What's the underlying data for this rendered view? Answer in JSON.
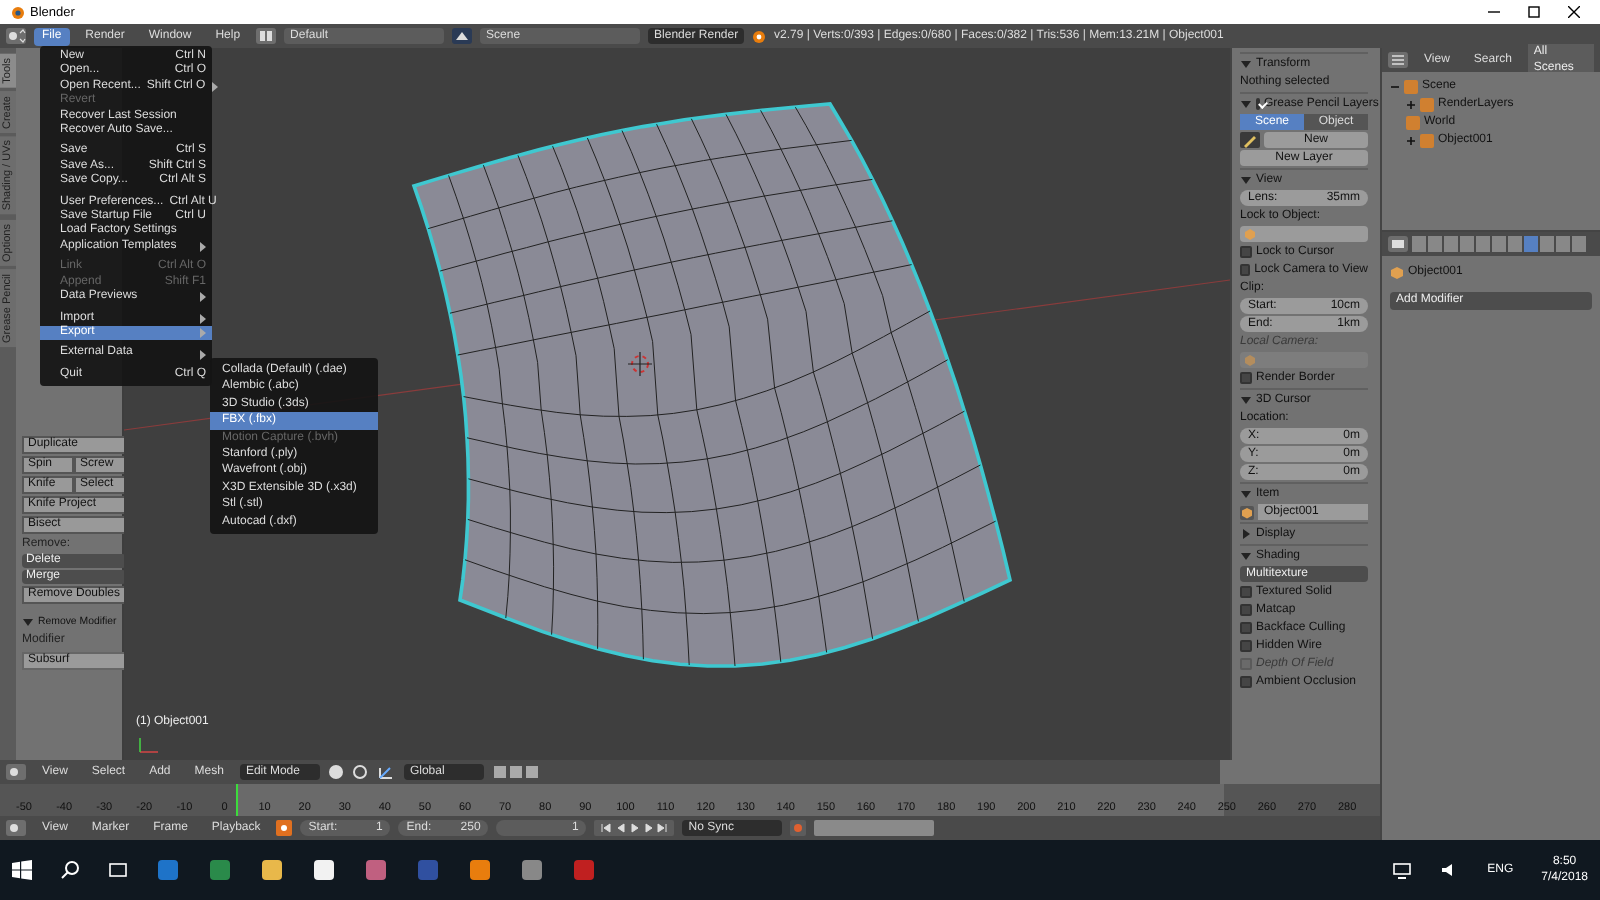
{
  "window": {
    "title": "Blender"
  },
  "info_header": {
    "menus": [
      {
        "label": "File",
        "selected": true
      },
      {
        "label": "Render",
        "selected": false
      },
      {
        "label": "Window",
        "selected": false
      },
      {
        "label": "Help",
        "selected": false
      }
    ],
    "layout": "Default",
    "scene": "Scene",
    "engine": "Blender Render",
    "stats": "v2.79 | Verts:0/393 | Edges:0/680 | Faces:0/382 | Tris:536 | Mem:13.21M | Object001"
  },
  "file_menu": {
    "items": [
      {
        "kind": "item",
        "label": "New",
        "shortcut": "Ctrl N",
        "disabled": false,
        "submenu": false,
        "selected": false
      },
      {
        "kind": "item",
        "label": "Open...",
        "shortcut": "Ctrl O",
        "disabled": false,
        "submenu": false,
        "selected": false
      },
      {
        "kind": "item",
        "label": "Open Recent...",
        "shortcut": "Shift Ctrl O",
        "disabled": false,
        "submenu": true,
        "selected": false
      },
      {
        "kind": "item",
        "label": "Revert",
        "disabled": true,
        "submenu": false,
        "selected": false
      },
      {
        "kind": "item",
        "label": "Recover Last Session",
        "disabled": false,
        "submenu": false,
        "selected": false
      },
      {
        "kind": "item",
        "label": "Recover Auto Save...",
        "disabled": false,
        "submenu": false,
        "selected": false
      },
      {
        "kind": "separator"
      },
      {
        "kind": "item",
        "label": "Save",
        "shortcut": "Ctrl S",
        "disabled": false,
        "submenu": false,
        "selected": false
      },
      {
        "kind": "item",
        "label": "Save As...",
        "shortcut": "Shift Ctrl S",
        "disabled": false,
        "submenu": false,
        "selected": false
      },
      {
        "kind": "item",
        "label": "Save Copy...",
        "shortcut": "Ctrl Alt S",
        "disabled": false,
        "submenu": false,
        "selected": false
      },
      {
        "kind": "separator"
      },
      {
        "kind": "item",
        "label": "User Preferences...",
        "shortcut": "Ctrl Alt U",
        "disabled": false,
        "submenu": false,
        "selected": false
      },
      {
        "kind": "item",
        "label": "Save Startup File",
        "shortcut": "Ctrl U",
        "disabled": false,
        "submenu": false,
        "selected": false
      },
      {
        "kind": "item",
        "label": "Load Factory Settings",
        "disabled": false,
        "submenu": false,
        "selected": false
      },
      {
        "kind": "item",
        "label": "Application Templates",
        "disabled": false,
        "submenu": true,
        "selected": false
      },
      {
        "kind": "separator"
      },
      {
        "kind": "item",
        "label": "Link",
        "shortcut": "Ctrl Alt O",
        "disabled": true,
        "submenu": false,
        "selected": false
      },
      {
        "kind": "item",
        "label": "Append",
        "shortcut": "Shift F1",
        "disabled": true,
        "submenu": false,
        "selected": false
      },
      {
        "kind": "item",
        "label": "Data Previews",
        "disabled": false,
        "submenu": true,
        "selected": false
      },
      {
        "kind": "separator"
      },
      {
        "kind": "item",
        "label": "Import",
        "disabled": false,
        "submenu": true,
        "selected": false
      },
      {
        "kind": "item",
        "label": "Export",
        "disabled": false,
        "submenu": true,
        "selected": true
      },
      {
        "kind": "separator"
      },
      {
        "kind": "item",
        "label": "External Data",
        "disabled": false,
        "submenu": true,
        "selected": false
      },
      {
        "kind": "separator"
      },
      {
        "kind": "item",
        "label": "Quit",
        "shortcut": "Ctrl Q",
        "disabled": false,
        "submenu": false,
        "selected": false
      }
    ]
  },
  "export_menu": {
    "items": [
      {
        "label": "Collada (Default) (.dae)",
        "disabled": false,
        "selected": false
      },
      {
        "label": "Alembic (.abc)",
        "disabled": false,
        "selected": false
      },
      {
        "label": "3D Studio (.3ds)",
        "disabled": false,
        "selected": false
      },
      {
        "label": "FBX (.fbx)",
        "disabled": false,
        "selected": true
      },
      {
        "label": "Motion Capture (.bvh)",
        "disabled": true,
        "selected": false
      },
      {
        "label": "Stanford (.ply)",
        "disabled": false,
        "selected": false
      },
      {
        "label": "Wavefront (.obj)",
        "disabled": false,
        "selected": false
      },
      {
        "label": "X3D Extensible 3D (.x3d)",
        "disabled": false,
        "selected": false
      },
      {
        "label": "Stl (.stl)",
        "disabled": false,
        "selected": false
      },
      {
        "label": "Autocad (.dxf)",
        "disabled": false,
        "selected": false
      }
    ]
  },
  "toolshelf": {
    "tabs": [
      {
        "label": "Tools",
        "selected": true
      },
      {
        "label": "Create",
        "selected": false
      },
      {
        "label": "Shading / UVs",
        "selected": false
      },
      {
        "label": "Options",
        "selected": false
      },
      {
        "label": "Grease Pencil",
        "selected": false
      }
    ],
    "rows": [
      {
        "kind": "buttons",
        "labels": [
          "Duplicate"
        ]
      },
      {
        "kind": "buttons",
        "labels": [
          "Spin",
          "Screw"
        ]
      },
      {
        "kind": "buttons",
        "labels": [
          "Knife",
          "Select"
        ]
      },
      {
        "kind": "buttons",
        "labels": [
          "Knife Project"
        ]
      },
      {
        "kind": "buttons",
        "labels": [
          "Bisect"
        ]
      },
      {
        "kind": "heading",
        "label": "Remove:"
      },
      {
        "kind": "dropdown",
        "label": "Delete"
      },
      {
        "kind": "dropdown",
        "label": "Merge"
      },
      {
        "kind": "buttons",
        "labels": [
          "Remove Doubles"
        ]
      }
    ],
    "operator": {
      "title": "Remove Modifier",
      "expanded": true,
      "field_label": "Modifier",
      "field_value": "Subsurf"
    }
  },
  "viewport": {
    "object_label": "(1) Object001"
  },
  "view3d_header": {
    "menus": [
      "View",
      "Select",
      "Add",
      "Mesh"
    ],
    "mode": "Edit Mode",
    "orientation": "Global"
  },
  "n_panel": {
    "rows": [
      {
        "kind": "panel",
        "label": "Transform",
        "expanded": true
      },
      {
        "kind": "text",
        "label": "Nothing selected"
      },
      {
        "kind": "panel_check",
        "label": "Grease Pencil Layers",
        "expanded": true,
        "checked": true
      },
      {
        "kind": "tabs",
        "items": [
          {
            "label": "Scene",
            "selected": true
          },
          {
            "label": "Object",
            "selected": false
          }
        ]
      },
      {
        "kind": "pencil_new",
        "label": "New"
      },
      {
        "kind": "button",
        "label": "New Layer"
      },
      {
        "kind": "panel",
        "label": "View",
        "expanded": true
      },
      {
        "kind": "number",
        "label": "Lens:",
        "value": "35mm"
      },
      {
        "kind": "label",
        "label": "Lock to Object:",
        "disabled": false
      },
      {
        "kind": "object_field",
        "disabled": false
      },
      {
        "kind": "check",
        "label": "Lock to Cursor",
        "checked": false,
        "disabled": false
      },
      {
        "kind": "check",
        "label": "Lock Camera to View",
        "checked": false,
        "disabled": false
      },
      {
        "kind": "label",
        "label": "Clip:",
        "disabled": false
      },
      {
        "kind": "number",
        "label": "Start:",
        "value": "10cm"
      },
      {
        "kind": "number",
        "label": "End:",
        "value": "1km"
      },
      {
        "kind": "label",
        "label": "Local Camera:",
        "disabled": true
      },
      {
        "kind": "object_field",
        "disabled": true
      },
      {
        "kind": "check",
        "label": "Render Border",
        "checked": false,
        "disabled": false
      },
      {
        "kind": "panel",
        "label": "3D Cursor",
        "expanded": true
      },
      {
        "kind": "label",
        "label": "Location:",
        "disabled": false
      },
      {
        "kind": "number",
        "label": "X:",
        "value": "0m"
      },
      {
        "kind": "number",
        "label": "Y:",
        "value": "0m"
      },
      {
        "kind": "number",
        "label": "Z:",
        "value": "0m"
      },
      {
        "kind": "panel",
        "label": "Item",
        "expanded": true
      },
      {
        "kind": "name_field",
        "value": "Object001"
      },
      {
        "kind": "panel",
        "label": "Display",
        "expanded": false
      },
      {
        "kind": "panel",
        "label": "Shading",
        "expanded": true
      },
      {
        "kind": "dropdown",
        "label": "Multitexture"
      },
      {
        "kind": "check",
        "label": "Textured Solid",
        "checked": false,
        "disabled": false
      },
      {
        "kind": "check",
        "label": "Matcap",
        "checked": false,
        "disabled": false
      },
      {
        "kind": "check",
        "label": "Backface Culling",
        "checked": false,
        "disabled": false
      },
      {
        "kind": "check",
        "label": "Hidden Wire",
        "checked": false,
        "disabled": false
      },
      {
        "kind": "check",
        "label": "Depth Of Field",
        "checked": false,
        "disabled": true
      },
      {
        "kind": "check",
        "label": "Ambient Occlusion",
        "checked": false,
        "disabled": false
      }
    ]
  },
  "outliner": {
    "menus": [
      "View",
      "Search"
    ],
    "filter": "All Scenes",
    "tree": [
      {
        "label": "Scene",
        "expanded": true,
        "children": [
          {
            "label": "RenderLayers",
            "expanded": false
          },
          {
            "label": "World"
          },
          {
            "label": "Object001",
            "expanded": false
          }
        ]
      }
    ]
  },
  "properties": {
    "object": "Object001",
    "add_modifier": "Add Modifier"
  },
  "timeline": {
    "ticks": [
      "-50",
      "-40",
      "-30",
      "-20",
      "-10",
      "0",
      "10",
      "20",
      "30",
      "40",
      "50",
      "60",
      "70",
      "80",
      "90",
      "100",
      "110",
      "120",
      "130",
      "140",
      "150",
      "160",
      "170",
      "180",
      "190",
      "200",
      "210",
      "220",
      "230",
      "240",
      "250",
      "260",
      "270",
      "280"
    ]
  },
  "timeline_header": {
    "menus": [
      "View",
      "Marker",
      "Frame",
      "Playback"
    ],
    "start": "Start:",
    "start_value": "1",
    "end": "End:",
    "end_value": "250",
    "current": "1",
    "sync": "No Sync"
  },
  "taskbar": {
    "language": "ENG",
    "time": "8:50",
    "date": "7/4/2018"
  }
}
